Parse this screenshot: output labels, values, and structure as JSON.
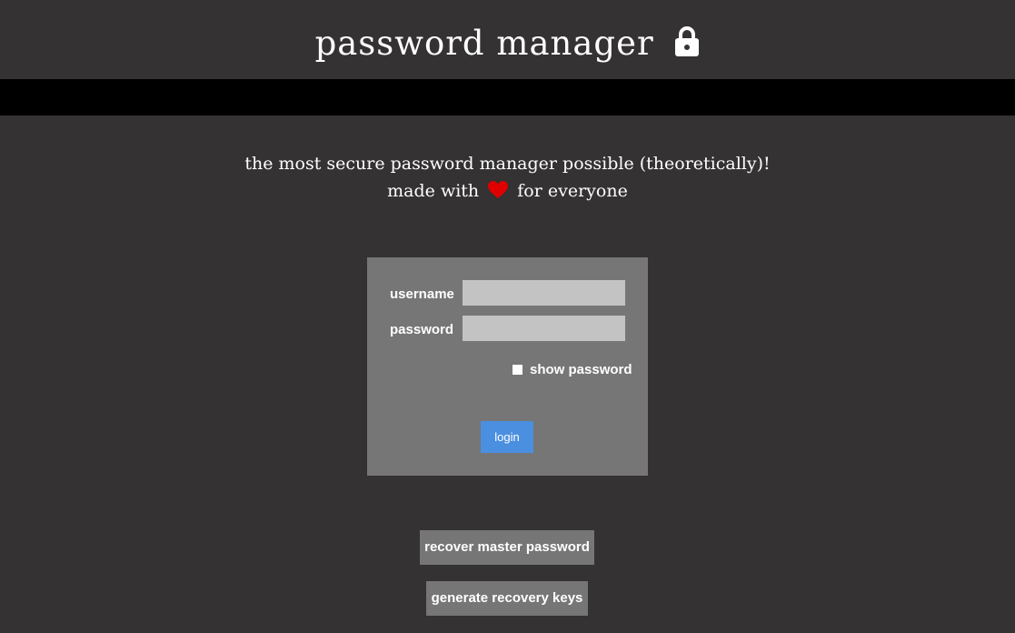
{
  "header": {
    "title": "password manager",
    "title_icon": "lock-icon"
  },
  "tagline": {
    "line1": "the most secure password manager possible (theoretically)!",
    "line2_before": "made with",
    "line2_icon": "heart-icon",
    "line2_after": "for everyone"
  },
  "login": {
    "username_label": "username",
    "username_value": "",
    "password_label": "password",
    "password_value": "",
    "show_password_label": "show password",
    "show_password_checked": false,
    "login_label": "login"
  },
  "actions": {
    "recover_label": "recover master password",
    "generate_label": "generate recovery keys"
  },
  "colors": {
    "background": "#343233",
    "bar": "#000000",
    "panel": "#767676",
    "input": "#c3c3c3",
    "accent": "#4a8fe0",
    "heart": "#e00000"
  }
}
